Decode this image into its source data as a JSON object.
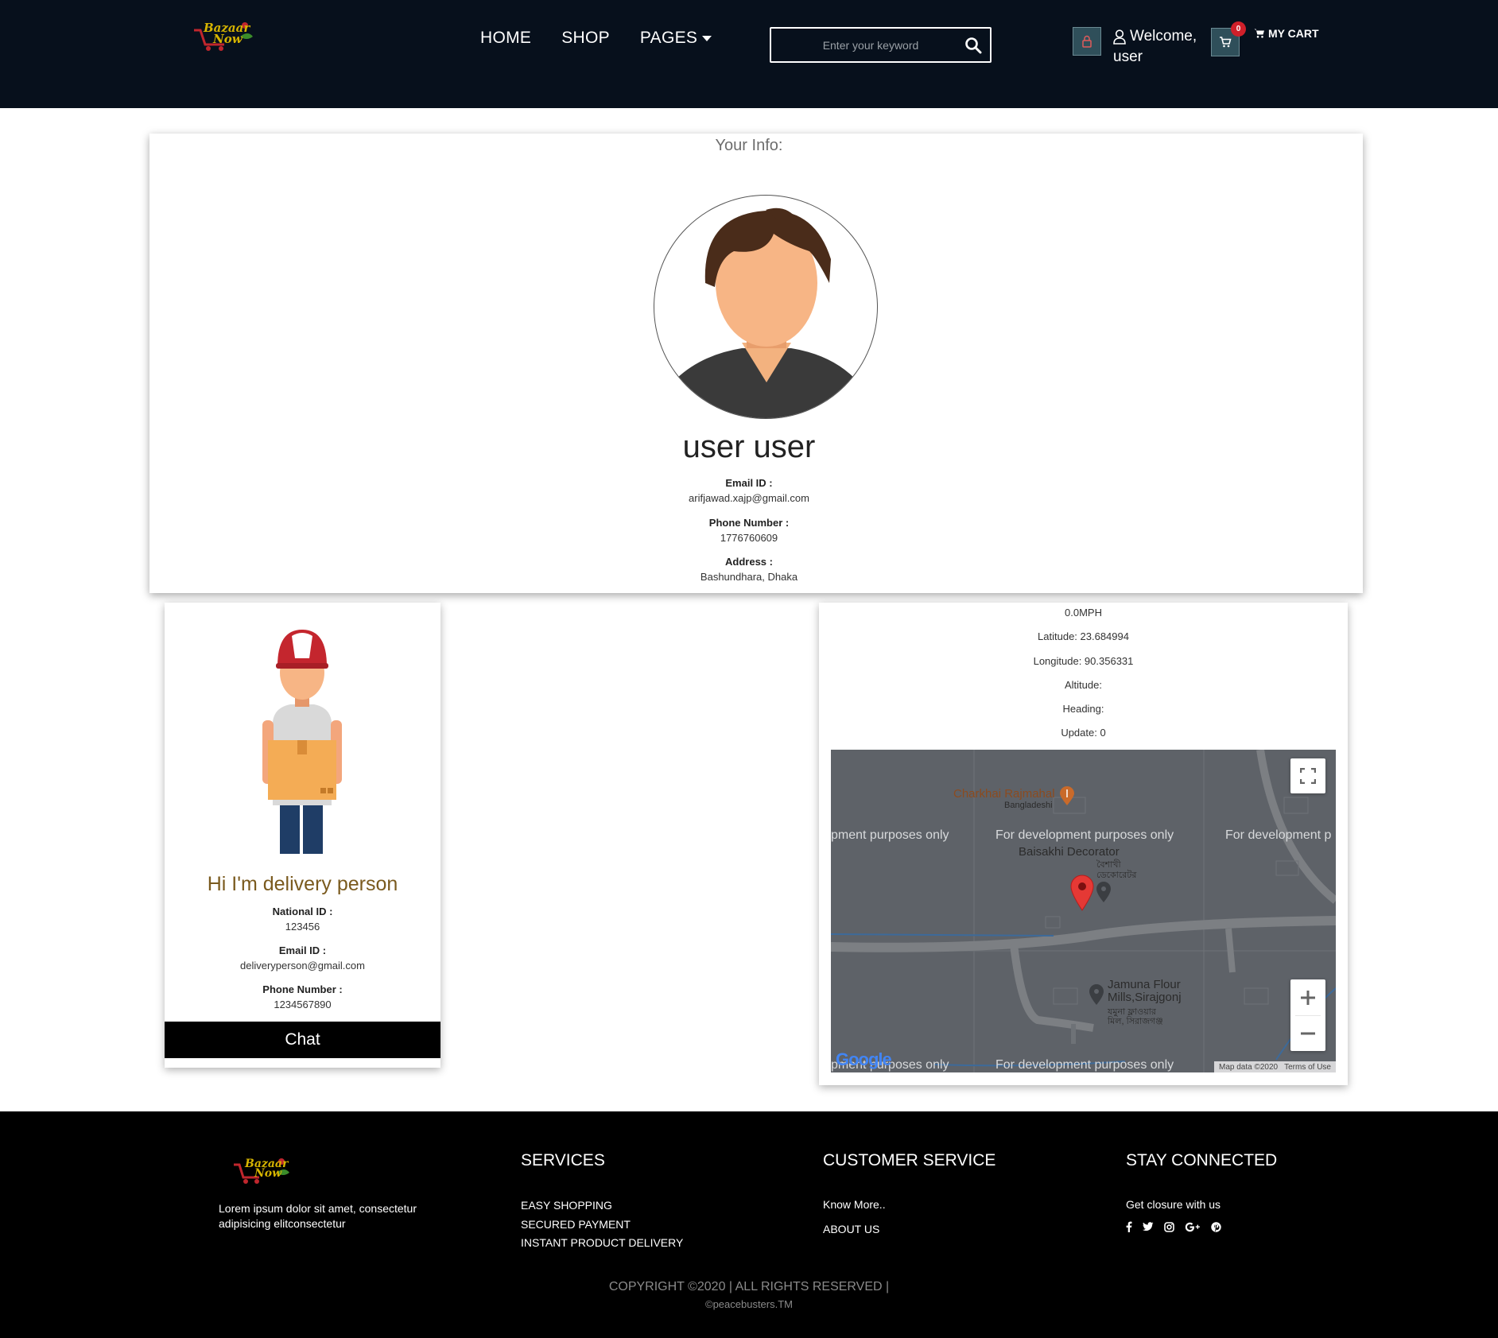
{
  "header": {
    "logo_text_1": "Bazaar",
    "logo_text_2": "Now",
    "nav": [
      {
        "label": "HOME"
      },
      {
        "label": "SHOP"
      },
      {
        "label": "PAGES"
      }
    ],
    "search": {
      "placeholder": "Enter your keyword",
      "value": ""
    },
    "welcome_line1": "Welcome,",
    "welcome_line2": "user",
    "cart_count": "0",
    "cart_label": "MY CART",
    "colors": {
      "background": "#07101c",
      "button": "#2f4f5a",
      "badge": "#d0202a"
    }
  },
  "user_info": {
    "title": "Your Info:",
    "name": "user user",
    "fields": [
      {
        "label": "Email ID :",
        "value": "arifjawad.xajp@gmail.com"
      },
      {
        "label": "Phone Number :",
        "value": "1776760609"
      },
      {
        "label": "Address :",
        "value": "Bashundhara, Dhaka"
      }
    ]
  },
  "delivery": {
    "greeting": "Hi I'm delivery person",
    "fields": [
      {
        "label": "National ID :",
        "value": "123456"
      },
      {
        "label": "Email ID :",
        "value": "deliveryperson@gmail.com"
      },
      {
        "label": "Phone Number :",
        "value": "1234567890"
      }
    ],
    "chat_label": "Chat"
  },
  "location": {
    "speed": "0.0MPH",
    "latitude": "Latitude: 23.684994",
    "longitude": "Longitude: 90.356331",
    "altitude": "Altitude:",
    "heading": "Heading:",
    "update": "Update: 0",
    "map": {
      "dev_text": "For development purposes only",
      "dev_text_left": "pment purposes only",
      "dev_text_right": "For development p",
      "dev_text_bottom_left": "pment purposes only",
      "poi_1": "Charkhai Rajmahal",
      "poi_1_sub": "Bangladeshi",
      "poi_2": "Baisakhi Decorator",
      "poi_2_sub_1": "বৈশাখী",
      "poi_2_sub_2": "ডেকোরেটর",
      "poi_3_line1": "Jamuna Flour",
      "poi_3_line2": "Mills,Sirajgonj",
      "poi_3_sub_1": "যমুনা ফ্লাওয়ার",
      "poi_3_sub_2": "মিল, সিরাজগঞ্জ",
      "google_logo": "Google",
      "map_data": "Map data ©2020",
      "terms": "Terms of Use"
    }
  },
  "footer": {
    "logo_text_1": "Bazaar",
    "logo_text_2": "Now",
    "about_line1": "Lorem ipsum dolor sit amet, consectetur",
    "about_line2": "adipisicing elitconsectetur",
    "services": {
      "title": "SERVICES",
      "items": [
        "EASY SHOPPING",
        "SECURED PAYMENT",
        "INSTANT PRODUCT DELIVERY"
      ]
    },
    "customer_service": {
      "title": "CUSTOMER SERVICE",
      "items": [
        "Know More..",
        "ABOUT US"
      ]
    },
    "stay_connected": {
      "title": "STAY CONNECTED",
      "text": "Get closure with us",
      "icons": [
        "facebook-icon",
        "twitter-icon",
        "instagram-icon",
        "google-plus-icon",
        "pinterest-icon"
      ]
    },
    "copyright": "COPYRIGHT ©2020 | ALL RIGHTS RESERVED |",
    "copyright_sub": "©peacebusters.TM"
  }
}
